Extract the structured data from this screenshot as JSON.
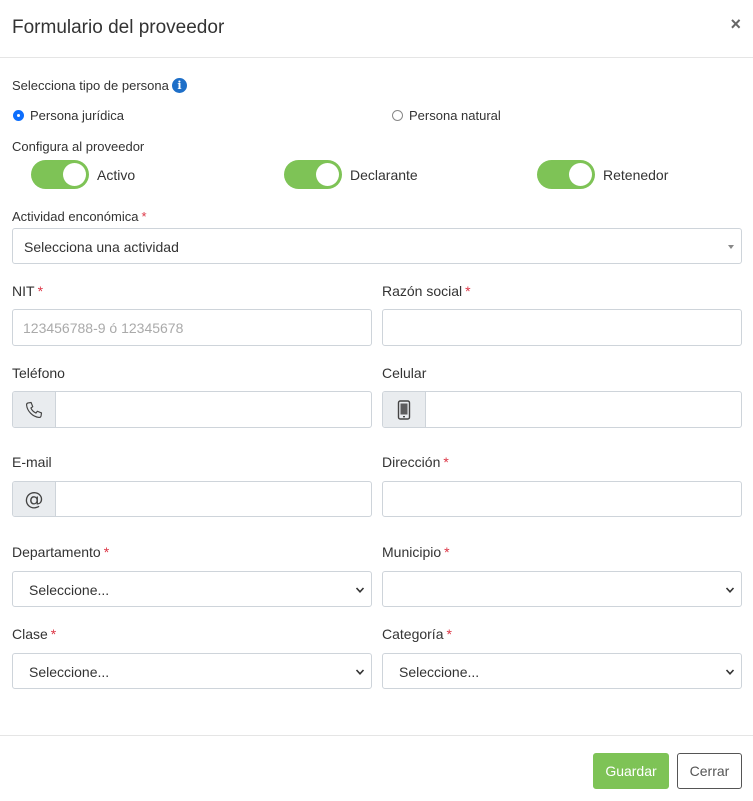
{
  "header": {
    "title": "Formulario del proveedor",
    "close_glyph": "×"
  },
  "persona": {
    "label": "Selecciona tipo de persona",
    "info_glyph": "i",
    "options": [
      {
        "label": "Persona jurídica",
        "checked": true
      },
      {
        "label": "Persona natural",
        "checked": false
      }
    ]
  },
  "config": {
    "label": "Configura al proveedor",
    "toggles": [
      {
        "label": "Activo",
        "on": true
      },
      {
        "label": "Declarante",
        "on": true
      },
      {
        "label": "Retenedor",
        "on": true
      }
    ]
  },
  "fields": {
    "actividad": {
      "label": "Actividad enconómica",
      "required": "*",
      "value": "Selecciona una actividad"
    },
    "nit": {
      "label": "NIT",
      "required": "*",
      "placeholder": "123456788-9 ó 12345678"
    },
    "razon": {
      "label": "Razón social",
      "required": "*"
    },
    "telefono": {
      "label": "Teléfono",
      "icon": "phone-icon"
    },
    "celular": {
      "label": "Celular",
      "icon": "mobile-icon"
    },
    "email": {
      "label": "E-mail",
      "icon": "at-icon",
      "glyph": "@"
    },
    "direccion": {
      "label": "Dirección",
      "required": "*"
    },
    "departamento": {
      "label": "Departamento",
      "required": "*",
      "value": "Seleccione..."
    },
    "municipio": {
      "label": "Municipio",
      "required": "*",
      "value": ""
    },
    "clase": {
      "label": "Clase",
      "required": "*",
      "value": "Seleccione..."
    },
    "categoria": {
      "label": "Categoría",
      "required": "*",
      "value": "Seleccione..."
    }
  },
  "footer": {
    "save_label": "Guardar",
    "close_label": "Cerrar"
  },
  "colors": {
    "accent_green": "#7ec356",
    "info_blue": "#1e6fc8",
    "radio_blue": "#0d6efd",
    "required_red": "#dc3545"
  }
}
